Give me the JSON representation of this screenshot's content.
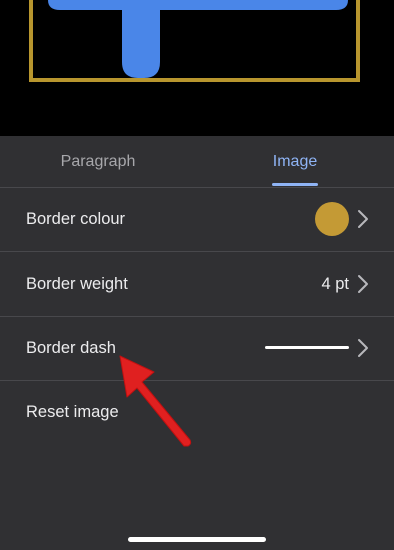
{
  "tabs": [
    {
      "label": "Paragraph",
      "active": false
    },
    {
      "label": "Image",
      "active": true
    }
  ],
  "settings": [
    {
      "label": "Border colour",
      "color": "#c49a35"
    },
    {
      "label": "Border weight",
      "value": "4 pt"
    },
    {
      "label": "Border dash",
      "style": "solid"
    },
    {
      "label": "Reset image"
    }
  ],
  "colors": {
    "image_frame": "#b8962e",
    "image_shape": "#4a86e8",
    "annotation_arrow": "#e02020",
    "active_tab": "#8fb4f5"
  },
  "icons": [
    "chevron-right-icon",
    "annotation-arrow-icon"
  ]
}
